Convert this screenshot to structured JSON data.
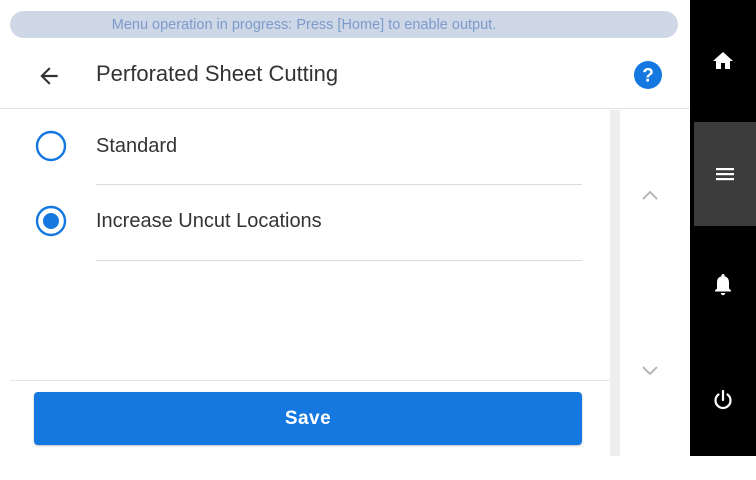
{
  "status_banner": {
    "text": "Menu operation in progress: Press [Home] to enable output."
  },
  "header": {
    "title": "Perforated Sheet Cutting",
    "back_icon": "arrow-left-icon",
    "help_icon": "question-circle-icon"
  },
  "options": [
    {
      "label": "Standard",
      "selected": false
    },
    {
      "label": "Increase Uncut Locations",
      "selected": true
    }
  ],
  "scroll": {
    "up_icon": "chevron-up-icon",
    "down_icon": "chevron-down-icon"
  },
  "footer": {
    "save_label": "Save"
  },
  "sidebar": {
    "items": [
      {
        "name": "home",
        "icon": "home-icon",
        "active": false
      },
      {
        "name": "menu",
        "icon": "hamburger-menu-icon",
        "active": true
      },
      {
        "name": "notifications",
        "icon": "bell-icon",
        "active": false
      },
      {
        "name": "power",
        "icon": "power-icon",
        "active": false
      }
    ]
  },
  "colors": {
    "accent": "#1578e0",
    "banner_bg": "#cdd7e5",
    "banner_text": "#7d9bcc",
    "sidebar_bg": "#000000",
    "sidebar_active": "#3c3c3c"
  }
}
